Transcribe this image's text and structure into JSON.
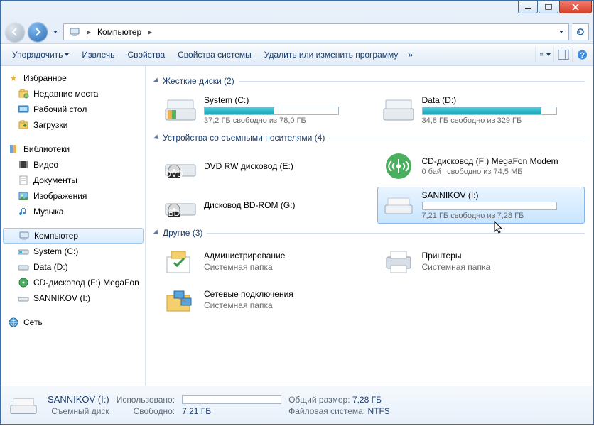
{
  "address": {
    "location": "Компьютер"
  },
  "toolbar": {
    "organize": "Упорядочить",
    "eject": "Извлечь",
    "properties": "Свойства",
    "system_properties": "Свойства системы",
    "uninstall": "Удалить или изменить программу"
  },
  "sidebar": {
    "favorites": {
      "title": "Избранное",
      "recent": "Недавние места",
      "desktop": "Рабочий стол",
      "downloads": "Загрузки"
    },
    "libraries": {
      "title": "Библиотеки",
      "videos": "Видео",
      "documents": "Документы",
      "pictures": "Изображения",
      "music": "Музыка"
    },
    "computer": {
      "title": "Компьютер",
      "system": "System (C:)",
      "data": "Data (D:)",
      "cd": "CD-дисковод (F:) MegaFon",
      "sannikov": "SANNIKOV (I:)"
    },
    "network": {
      "title": "Сеть"
    }
  },
  "groups": {
    "hdd": {
      "title": "Жесткие диски (2)",
      "c": {
        "name": "System (C:)",
        "sub": "37,2 ГБ свободно из 78,0 ГБ",
        "fill": 52
      },
      "d": {
        "name": "Data (D:)",
        "sub": "34,8 ГБ свободно из 329 ГБ",
        "fill": 89
      }
    },
    "removable": {
      "title": "Устройства со съемными носителями (4)",
      "dvd": {
        "name": "DVD RW дисковод (E:)"
      },
      "bd": {
        "name": "Дисковод BD-ROM (G:)"
      },
      "megafon": {
        "name": "CD-дисковод (F:) MegaFon Modem",
        "sub": "0 байт свободно из 74,5 МБ"
      },
      "sannikov": {
        "name": "SANNIKOV (I:)",
        "sub": "7,21 ГБ свободно из 7,28 ГБ",
        "fill": 1
      }
    },
    "other": {
      "title": "Другие (3)",
      "admin": {
        "name": "Администрирование",
        "sub": "Системная папка"
      },
      "net": {
        "name": "Сетевые подключения",
        "sub": "Системная папка"
      },
      "print": {
        "name": "Принтеры",
        "sub": "Системная папка"
      }
    }
  },
  "status": {
    "name": "SANNIKOV (I:)",
    "type": "Съемный диск",
    "used_lbl": "Использовано:",
    "free_lbl": "Свободно:",
    "free_val": "7,21 ГБ",
    "total_lbl": "Общий размер:",
    "total_val": "7,28 ГБ",
    "fs_lbl": "Файловая система:",
    "fs_val": "NTFS"
  }
}
